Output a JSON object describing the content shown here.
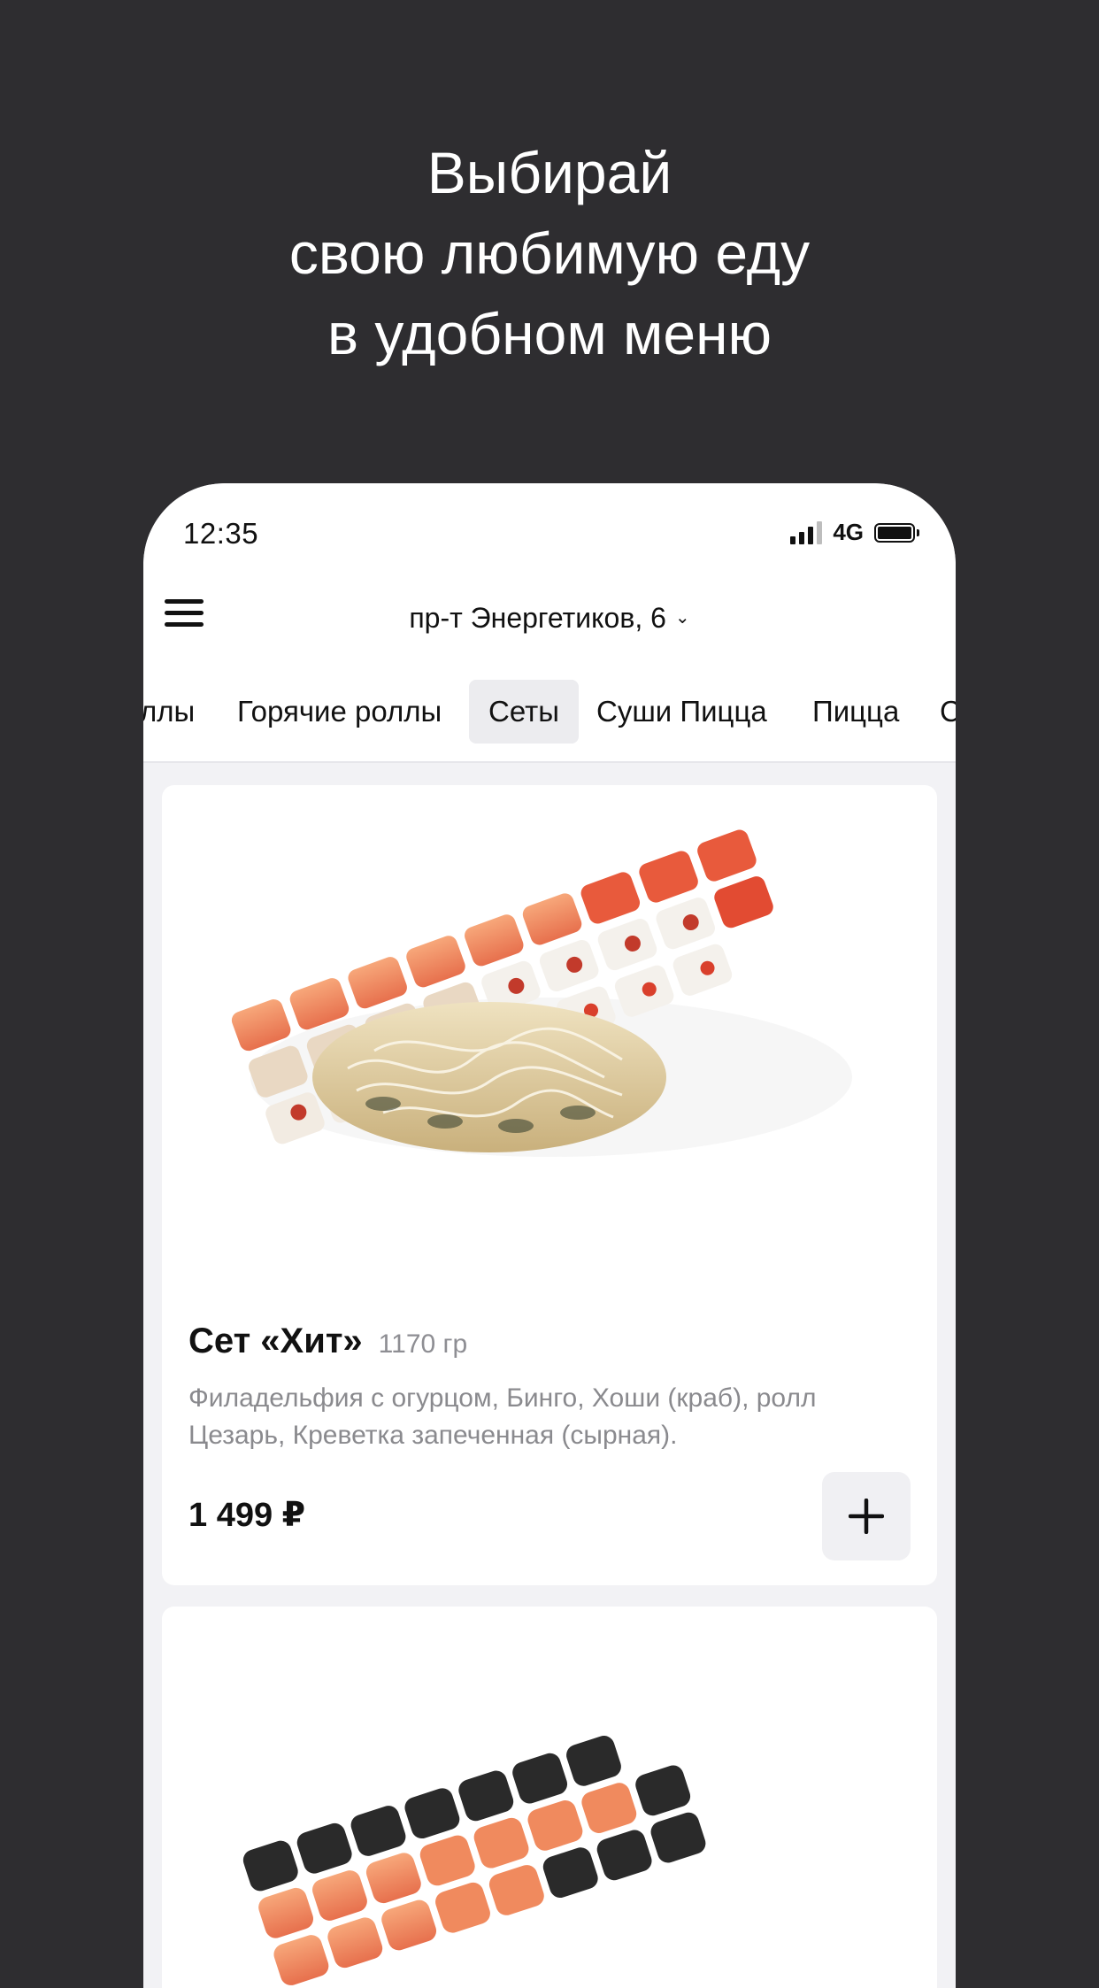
{
  "headline": [
    "Выбирай",
    "свою любимую еду",
    "в удобном меню"
  ],
  "status_bar": {
    "time": "12:35",
    "network": "4G"
  },
  "header": {
    "address": "пр-т Энергетиков, 6",
    "address_chevron": "chevron-down-icon",
    "menu_icon": "hamburger-menu-icon"
  },
  "tabs": [
    {
      "label": "ллы"
    },
    {
      "label": "Горячие роллы"
    },
    {
      "label": "Сеты",
      "active": true
    },
    {
      "label": "Суши Пицца"
    },
    {
      "label": "Пицца"
    },
    {
      "label": "С"
    }
  ],
  "products": [
    {
      "title": "Сет «Хит»",
      "weight": "1170 гр",
      "description": "Филадельфия с огурцом, Бинго, Хоши (краб), ролл Цезарь, Креветка запеченная (сырная).",
      "price": "1 499 ₽",
      "add_icon": "plus-icon"
    },
    {
      "image": "sushi-set-photo"
    }
  ],
  "colors": {
    "background": "#2e2d30",
    "card": "#ffffff",
    "list_bg": "#f2f2f5",
    "muted_text": "#8a8a8e"
  }
}
